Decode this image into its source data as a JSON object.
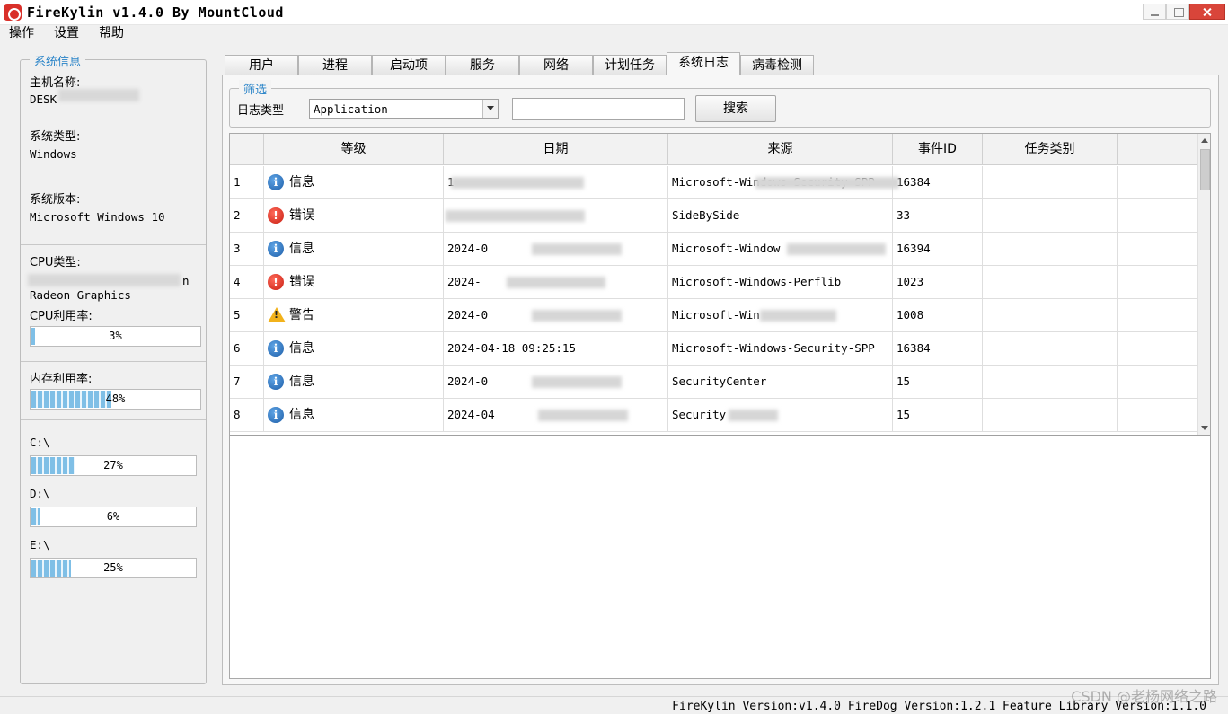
{
  "window": {
    "title": "FireKylin v1.4.0 By MountCloud"
  },
  "menu": [
    "操作",
    "设置",
    "帮助"
  ],
  "sysinfo": {
    "legend": "系统信息",
    "host_label": "主机名称:",
    "host_value": "DESK",
    "os_type_label": "系统类型:",
    "os_type_value": "Windows",
    "os_version_label": "系统版本:",
    "os_version_value": "Microsoft Windows 10",
    "cpu_type_label": "CPU类型:",
    "cpu_type_suffix": "n",
    "cpu_type_value2": "Radeon Graphics",
    "cpu_usage_label": "CPU利用率:",
    "cpu_usage": {
      "value": 3,
      "text": "3%"
    },
    "mem_usage_label": "内存利用率:",
    "mem_usage": {
      "value": 48,
      "text": "48%"
    },
    "disks": [
      {
        "label": "C:\\",
        "value": 27,
        "text": "27%"
      },
      {
        "label": "D:\\",
        "value": 6,
        "text": "6%"
      },
      {
        "label": "E:\\",
        "value": 25,
        "text": "25%"
      }
    ]
  },
  "tabs": [
    {
      "label": "用户",
      "active": false
    },
    {
      "label": "进程",
      "active": false
    },
    {
      "label": "启动项",
      "active": false
    },
    {
      "label": "服务",
      "active": false
    },
    {
      "label": "网络",
      "active": false
    },
    {
      "label": "计划任务",
      "active": false
    },
    {
      "label": "系统日志",
      "active": true
    },
    {
      "label": "病毒检测",
      "active": false
    }
  ],
  "filter": {
    "legend": "筛选",
    "log_type_label": "日志类型",
    "log_type_value": "Application",
    "search_value": "",
    "search_button": "搜索"
  },
  "table": {
    "columns": [
      "",
      "等级",
      "日期",
      "来源",
      "事件ID",
      "任务类别"
    ],
    "rows": [
      {
        "n": "1",
        "level": "信息",
        "level_type": "info",
        "date": "1",
        "source": "Microsoft-Windows-Security-SPP",
        "event_id": "16384",
        "category": ""
      },
      {
        "n": "2",
        "level": "错误",
        "level_type": "error",
        "date": "",
        "source": "SideBySide",
        "event_id": "33",
        "category": ""
      },
      {
        "n": "3",
        "level": "信息",
        "level_type": "info",
        "date": "2024-0",
        "source": "Microsoft-Window",
        "event_id": "16394",
        "category": ""
      },
      {
        "n": "4",
        "level": "错误",
        "level_type": "error",
        "date": "2024-",
        "source": "Microsoft-Windows-Perflib",
        "event_id": "1023",
        "category": ""
      },
      {
        "n": "5",
        "level": "警告",
        "level_type": "warn",
        "date": "2024-0",
        "source": "Microsoft-Win",
        "event_id": "1008",
        "category": ""
      },
      {
        "n": "6",
        "level": "信息",
        "level_type": "info",
        "date": "2024-04-18 09:25:15",
        "source": "Microsoft-Windows-Security-SPP",
        "event_id": "16384",
        "category": ""
      },
      {
        "n": "7",
        "level": "信息",
        "level_type": "info",
        "date": "2024-0",
        "source": "SecurityCenter",
        "event_id": "15",
        "category": ""
      },
      {
        "n": "8",
        "level": "信息",
        "level_type": "info",
        "date": "2024-04",
        "source": "Security",
        "event_id": "15",
        "category": ""
      }
    ]
  },
  "status": {
    "text": "FireKylin Version:v1.4.0 FireDog Version:1.2.1 Feature Library Version:1.1.0"
  },
  "watermark": "CSDN @老杨网络之路",
  "colors": {
    "accent": "#2a84c8",
    "progress": "#7fbfe6",
    "info": "#1e5ea8",
    "error": "#c81e12",
    "warning": "#f2b21b"
  }
}
